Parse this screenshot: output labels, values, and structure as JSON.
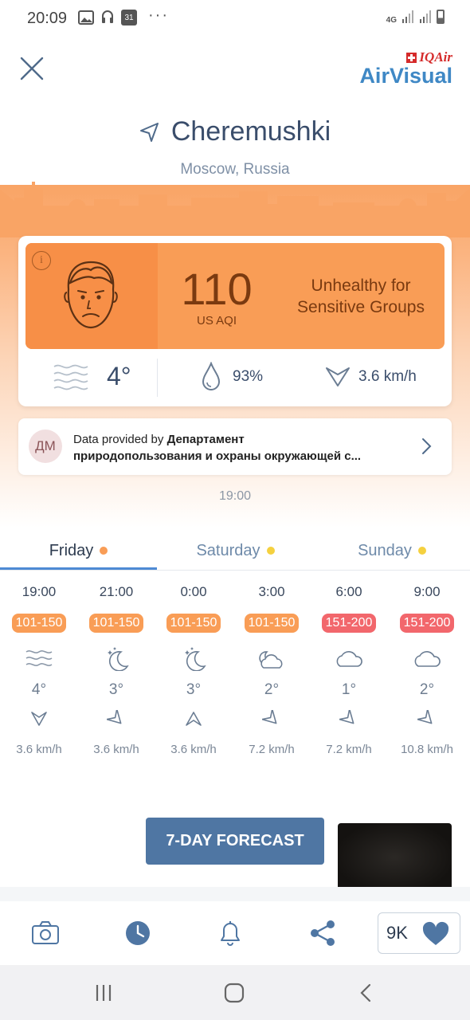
{
  "status_bar": {
    "time": "20:09",
    "calendar_day": "31",
    "more": "···",
    "network": "4G"
  },
  "header": {
    "logo_brand": "IQAir",
    "logo_product": "AirVisual",
    "location_icon": "location-arrow-icon",
    "city": "Cheremushki",
    "region": "Moscow, Russia"
  },
  "aqi": {
    "value": "110",
    "unit": "US AQI",
    "status": "Unhealthy for Sensitive Groups",
    "color": "#f99d56",
    "face_icon": "sad-face-icon"
  },
  "current_weather": {
    "temperature": "4°",
    "humidity": "93%",
    "wind_speed": "3.6 km/h"
  },
  "provider": {
    "avatar": "ДМ",
    "prefix": "Data provided by ",
    "name_line1": "Департамент",
    "name_line2": "природопользования и охраны окружающей с..."
  },
  "updated_time": "19:00",
  "tabs": [
    {
      "label": "Friday",
      "dot_color": "#f99d56"
    },
    {
      "label": "Saturday",
      "dot_color": "#f5d13f"
    },
    {
      "label": "Sunday",
      "dot_color": "#f5d13f"
    }
  ],
  "forecast": [
    {
      "time": "19:00",
      "aqi": "101-150",
      "aqi_color": "#f99d56",
      "icon": "wind-waves-icon",
      "temp": "4°",
      "wind_dir_deg": 180,
      "wind": "3.6 km/h"
    },
    {
      "time": "21:00",
      "aqi": "101-150",
      "aqi_color": "#f99d56",
      "icon": "moon-stars-icon",
      "temp": "3°",
      "wind_dir_deg": 225,
      "wind": "3.6 km/h"
    },
    {
      "time": "0:00",
      "aqi": "101-150",
      "aqi_color": "#f99d56",
      "icon": "moon-stars-icon",
      "temp": "3°",
      "wind_dir_deg": 135,
      "wind": "3.6 km/h"
    },
    {
      "time": "3:00",
      "aqi": "101-150",
      "aqi_color": "#f99d56",
      "icon": "cloud-moon-icon",
      "temp": "2°",
      "wind_dir_deg": 225,
      "wind": "7.2 km/h"
    },
    {
      "time": "6:00",
      "aqi": "151-200",
      "aqi_color": "#f2676c",
      "icon": "cloud-icon",
      "temp": "1°",
      "wind_dir_deg": 225,
      "wind": "7.2 km/h"
    },
    {
      "time": "9:00",
      "aqi": "151-200",
      "aqi_color": "#f2676c",
      "icon": "cloud-icon",
      "temp": "2°",
      "wind_dir_deg": 225,
      "wind": "10.8 km/h"
    }
  ],
  "forecast_button": "7-DAY FORECAST",
  "bottom_bar": {
    "items": [
      "camera-icon",
      "history-clock-icon",
      "bell-icon",
      "share-icon"
    ],
    "likes": "9K"
  },
  "colors": {
    "accent": "#4f76a3",
    "orange": "#f99d56",
    "red": "#f2676c",
    "yellow": "#f5d13f",
    "brand_blue": "#3f88c5"
  }
}
